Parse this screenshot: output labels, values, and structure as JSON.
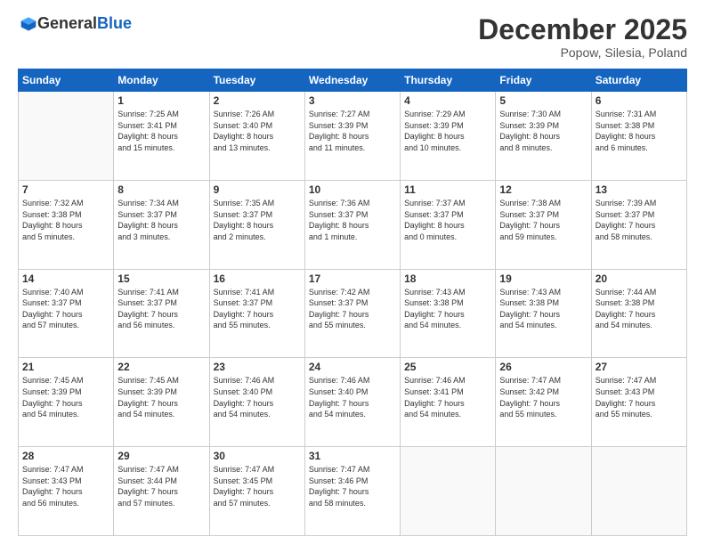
{
  "header": {
    "logo_general": "General",
    "logo_blue": "Blue",
    "month_title": "December 2025",
    "location": "Popow, Silesia, Poland"
  },
  "days_of_week": [
    "Sunday",
    "Monday",
    "Tuesday",
    "Wednesday",
    "Thursday",
    "Friday",
    "Saturday"
  ],
  "weeks": [
    [
      {
        "day": "",
        "empty": true,
        "content": ""
      },
      {
        "day": "1",
        "content": "Sunrise: 7:25 AM\nSunset: 3:41 PM\nDaylight: 8 hours\nand 15 minutes."
      },
      {
        "day": "2",
        "content": "Sunrise: 7:26 AM\nSunset: 3:40 PM\nDaylight: 8 hours\nand 13 minutes."
      },
      {
        "day": "3",
        "content": "Sunrise: 7:27 AM\nSunset: 3:39 PM\nDaylight: 8 hours\nand 11 minutes."
      },
      {
        "day": "4",
        "content": "Sunrise: 7:29 AM\nSunset: 3:39 PM\nDaylight: 8 hours\nand 10 minutes."
      },
      {
        "day": "5",
        "content": "Sunrise: 7:30 AM\nSunset: 3:39 PM\nDaylight: 8 hours\nand 8 minutes."
      },
      {
        "day": "6",
        "content": "Sunrise: 7:31 AM\nSunset: 3:38 PM\nDaylight: 8 hours\nand 6 minutes."
      }
    ],
    [
      {
        "day": "7",
        "content": "Sunrise: 7:32 AM\nSunset: 3:38 PM\nDaylight: 8 hours\nand 5 minutes."
      },
      {
        "day": "8",
        "content": "Sunrise: 7:34 AM\nSunset: 3:37 PM\nDaylight: 8 hours\nand 3 minutes."
      },
      {
        "day": "9",
        "content": "Sunrise: 7:35 AM\nSunset: 3:37 PM\nDaylight: 8 hours\nand 2 minutes."
      },
      {
        "day": "10",
        "content": "Sunrise: 7:36 AM\nSunset: 3:37 PM\nDaylight: 8 hours\nand 1 minute."
      },
      {
        "day": "11",
        "content": "Sunrise: 7:37 AM\nSunset: 3:37 PM\nDaylight: 8 hours\nand 0 minutes."
      },
      {
        "day": "12",
        "content": "Sunrise: 7:38 AM\nSunset: 3:37 PM\nDaylight: 7 hours\nand 59 minutes."
      },
      {
        "day": "13",
        "content": "Sunrise: 7:39 AM\nSunset: 3:37 PM\nDaylight: 7 hours\nand 58 minutes."
      }
    ],
    [
      {
        "day": "14",
        "content": "Sunrise: 7:40 AM\nSunset: 3:37 PM\nDaylight: 7 hours\nand 57 minutes."
      },
      {
        "day": "15",
        "content": "Sunrise: 7:41 AM\nSunset: 3:37 PM\nDaylight: 7 hours\nand 56 minutes."
      },
      {
        "day": "16",
        "content": "Sunrise: 7:41 AM\nSunset: 3:37 PM\nDaylight: 7 hours\nand 55 minutes."
      },
      {
        "day": "17",
        "content": "Sunrise: 7:42 AM\nSunset: 3:37 PM\nDaylight: 7 hours\nand 55 minutes."
      },
      {
        "day": "18",
        "content": "Sunrise: 7:43 AM\nSunset: 3:38 PM\nDaylight: 7 hours\nand 54 minutes."
      },
      {
        "day": "19",
        "content": "Sunrise: 7:43 AM\nSunset: 3:38 PM\nDaylight: 7 hours\nand 54 minutes."
      },
      {
        "day": "20",
        "content": "Sunrise: 7:44 AM\nSunset: 3:38 PM\nDaylight: 7 hours\nand 54 minutes."
      }
    ],
    [
      {
        "day": "21",
        "content": "Sunrise: 7:45 AM\nSunset: 3:39 PM\nDaylight: 7 hours\nand 54 minutes."
      },
      {
        "day": "22",
        "content": "Sunrise: 7:45 AM\nSunset: 3:39 PM\nDaylight: 7 hours\nand 54 minutes."
      },
      {
        "day": "23",
        "content": "Sunrise: 7:46 AM\nSunset: 3:40 PM\nDaylight: 7 hours\nand 54 minutes."
      },
      {
        "day": "24",
        "content": "Sunrise: 7:46 AM\nSunset: 3:40 PM\nDaylight: 7 hours\nand 54 minutes."
      },
      {
        "day": "25",
        "content": "Sunrise: 7:46 AM\nSunset: 3:41 PM\nDaylight: 7 hours\nand 54 minutes."
      },
      {
        "day": "26",
        "content": "Sunrise: 7:47 AM\nSunset: 3:42 PM\nDaylight: 7 hours\nand 55 minutes."
      },
      {
        "day": "27",
        "content": "Sunrise: 7:47 AM\nSunset: 3:43 PM\nDaylight: 7 hours\nand 55 minutes."
      }
    ],
    [
      {
        "day": "28",
        "content": "Sunrise: 7:47 AM\nSunset: 3:43 PM\nDaylight: 7 hours\nand 56 minutes."
      },
      {
        "day": "29",
        "content": "Sunrise: 7:47 AM\nSunset: 3:44 PM\nDaylight: 7 hours\nand 57 minutes."
      },
      {
        "day": "30",
        "content": "Sunrise: 7:47 AM\nSunset: 3:45 PM\nDaylight: 7 hours\nand 57 minutes."
      },
      {
        "day": "31",
        "content": "Sunrise: 7:47 AM\nSunset: 3:46 PM\nDaylight: 7 hours\nand 58 minutes."
      },
      {
        "day": "",
        "empty": true,
        "content": ""
      },
      {
        "day": "",
        "empty": true,
        "content": ""
      },
      {
        "day": "",
        "empty": true,
        "content": ""
      }
    ]
  ]
}
